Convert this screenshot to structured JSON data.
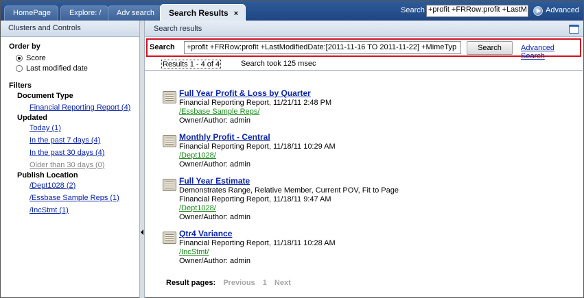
{
  "tabs": [
    {
      "label": "HomePage"
    },
    {
      "label": "Explore: /"
    },
    {
      "label": "Adv search"
    },
    {
      "label": "Search Results"
    }
  ],
  "tab_close_symbol": "×",
  "top_search": {
    "label": "Search",
    "value": "+profit +FRRow:profit +LastM",
    "advanced_label": "Advanced"
  },
  "left_panel": {
    "title": "Clusters and Controls",
    "order_by": {
      "title": "Order by",
      "options": [
        {
          "label": "Score",
          "selected": true
        },
        {
          "label": "Last modified date",
          "selected": false
        }
      ]
    },
    "filters": {
      "title": "Filters",
      "document_type": {
        "title": "Document Type",
        "items": [
          "Financial Reporting Report (4)"
        ]
      },
      "updated": {
        "title": "Updated",
        "items": [
          "Today (1)",
          "In the past 7 days (4)",
          "In the past 30 days (4)",
          "Older than 30 days (0)"
        ]
      },
      "publish_location": {
        "title": "Publish Location",
        "items": [
          "/Dept1028 (2)",
          "/Essbase Sample Reps (1)",
          "/IncStmt (1)"
        ]
      }
    }
  },
  "main": {
    "title": "Search results",
    "search_label": "Search",
    "query": "+profit +FRRow:profit +LastModifiedDate:[2011-11-16 TO 2011-11-22] +MimeTyp",
    "search_button": "Search",
    "advanced_link": "Advanced Search",
    "results_count": "Results  1 - 4  of  4",
    "search_time": "Search took 125 msec",
    "results": [
      {
        "title": "Full Year Profit & Loss by Quarter",
        "description": "",
        "meta": "Financial Reporting Report, 11/21/11 2:48 PM",
        "path": "/Essbase Sample Reps/",
        "owner": "Owner/Author: admin"
      },
      {
        "title": "Monthly Profit - Central",
        "description": "",
        "meta": "Financial Reporting Report, 11/18/11 10:29 AM",
        "path": "/Dept1028/",
        "owner": "Owner/Author: admin"
      },
      {
        "title": "Full Year Estimate",
        "description": "Demonstrates Range, Relative Member, Current POV, Fit to Page",
        "meta": "Financial Reporting Report, 11/18/11 9:47 AM",
        "path": "/Dept1028/",
        "owner": "Owner/Author: admin"
      },
      {
        "title": "Qtr4 Variance",
        "description": "",
        "meta": "Financial Reporting Report, 11/18/11 10:28 AM",
        "path": "/IncStmt/",
        "owner": "Owner/Author: admin"
      }
    ],
    "pager": {
      "label": "Result pages:",
      "previous": "Previous",
      "page": "1",
      "next": "Next"
    }
  },
  "colors": {
    "accent": "#1f4682",
    "link": "#0b24a8",
    "path": "#1a8a1a",
    "highlight_border": "#d0101f"
  },
  "icons": [
    "close-icon",
    "go-arrow-icon",
    "maximize-icon",
    "collapse-arrow-icon",
    "report-document-icon"
  ]
}
